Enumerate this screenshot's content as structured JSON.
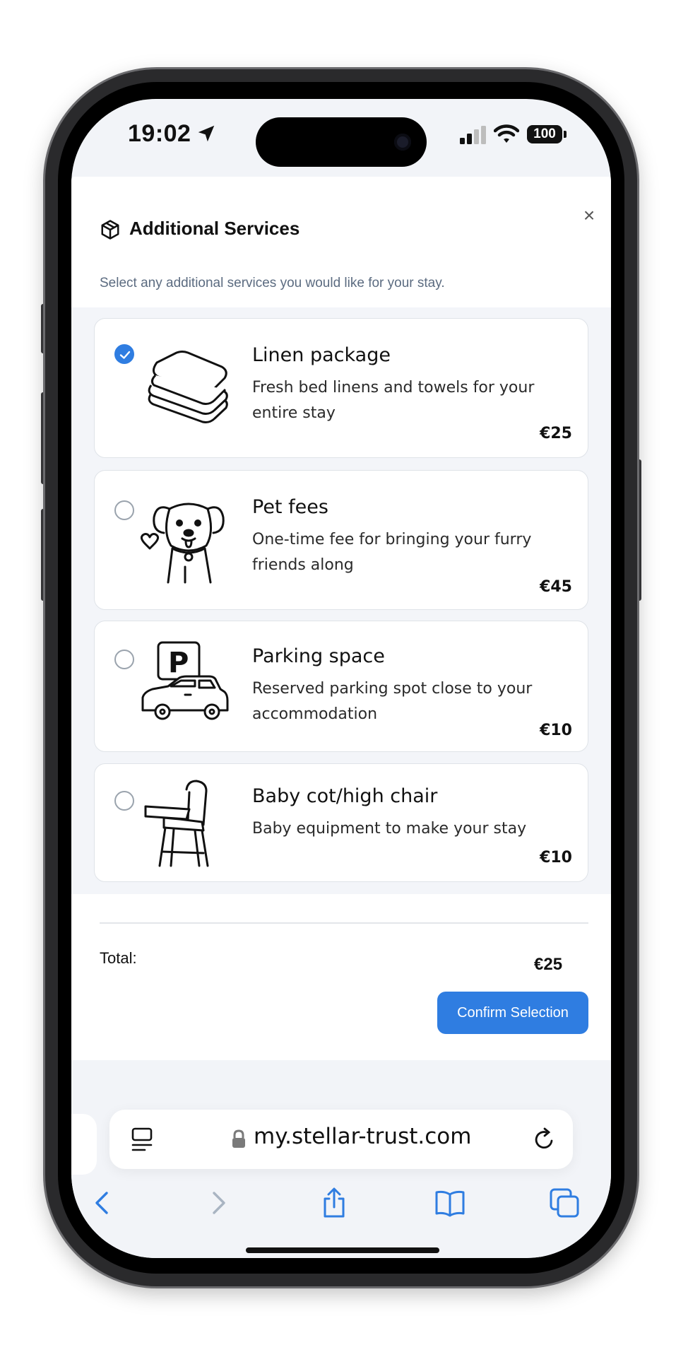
{
  "status_bar": {
    "time": "19:02",
    "battery": "100"
  },
  "modal": {
    "title": "Additional Services",
    "subtitle": "Select any additional services you would like for your stay.",
    "close_label": "×"
  },
  "services": [
    {
      "title": "Linen package",
      "description": "Fresh bed linens and towels for your entire stay",
      "price": "€25",
      "selected": true,
      "icon": "towels-icon"
    },
    {
      "title": "Pet fees",
      "description": "One-time fee for bringing your furry friends along",
      "price": "€45",
      "selected": false,
      "icon": "dog-icon"
    },
    {
      "title": "Parking space",
      "description": "Reserved parking spot close to your accommodation",
      "price": "€10",
      "selected": false,
      "icon": "parking-car-icon"
    },
    {
      "title": "Baby cot/high chair",
      "description": "Baby equipment to make your stay",
      "price": "€10",
      "selected": false,
      "icon": "high-chair-icon"
    }
  ],
  "footer": {
    "total_label": "Total:",
    "total_value": "€25",
    "confirm_label": "Confirm Selection"
  },
  "browser": {
    "url": "my.stellar-trust.com"
  },
  "colors": {
    "accent": "#2f7de1",
    "subtitle": "#5b6b80"
  }
}
